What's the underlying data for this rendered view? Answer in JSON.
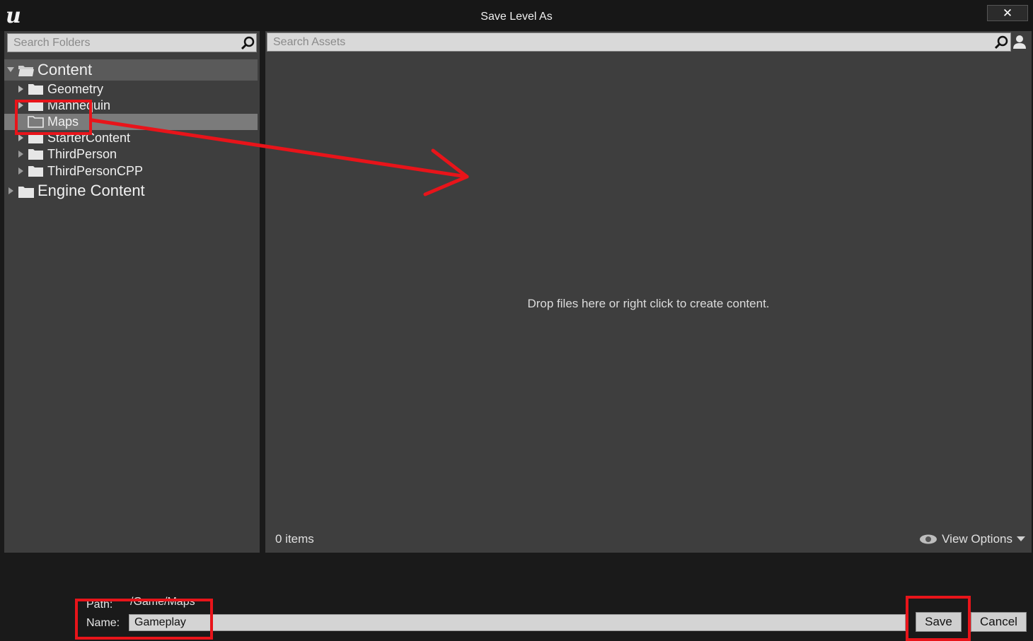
{
  "window": {
    "title": "Save Level As",
    "close_label": "✕"
  },
  "folders": {
    "search_placeholder": "Search Folders",
    "tree": {
      "root": "Content",
      "children": [
        "Geometry",
        "Mannequin",
        "Maps",
        "StarterContent",
        "ThirdPerson",
        "ThirdPersonCPP"
      ],
      "selected": "Maps",
      "engine_root": "Engine Content"
    }
  },
  "assets": {
    "search_placeholder": "Search Assets",
    "empty_message": "Drop files here or right click to create content.",
    "item_count": "0 items",
    "view_options_label": "View Options"
  },
  "save_form": {
    "path_label": "Path:",
    "path_value": "/Game/Maps",
    "name_label": "Name:",
    "name_value": "Gameplay",
    "save_label": "Save",
    "cancel_label": "Cancel"
  },
  "colors": {
    "annotation_red": "#e8141a",
    "panel_bg": "#3e3e3e",
    "selection_bg": "#7b7b7b"
  },
  "icons": [
    "unreal-logo-icon",
    "close-icon",
    "search-icon",
    "folder-icon",
    "folder-open-icon",
    "user-icon",
    "eye-icon",
    "chevron-down-icon"
  ]
}
